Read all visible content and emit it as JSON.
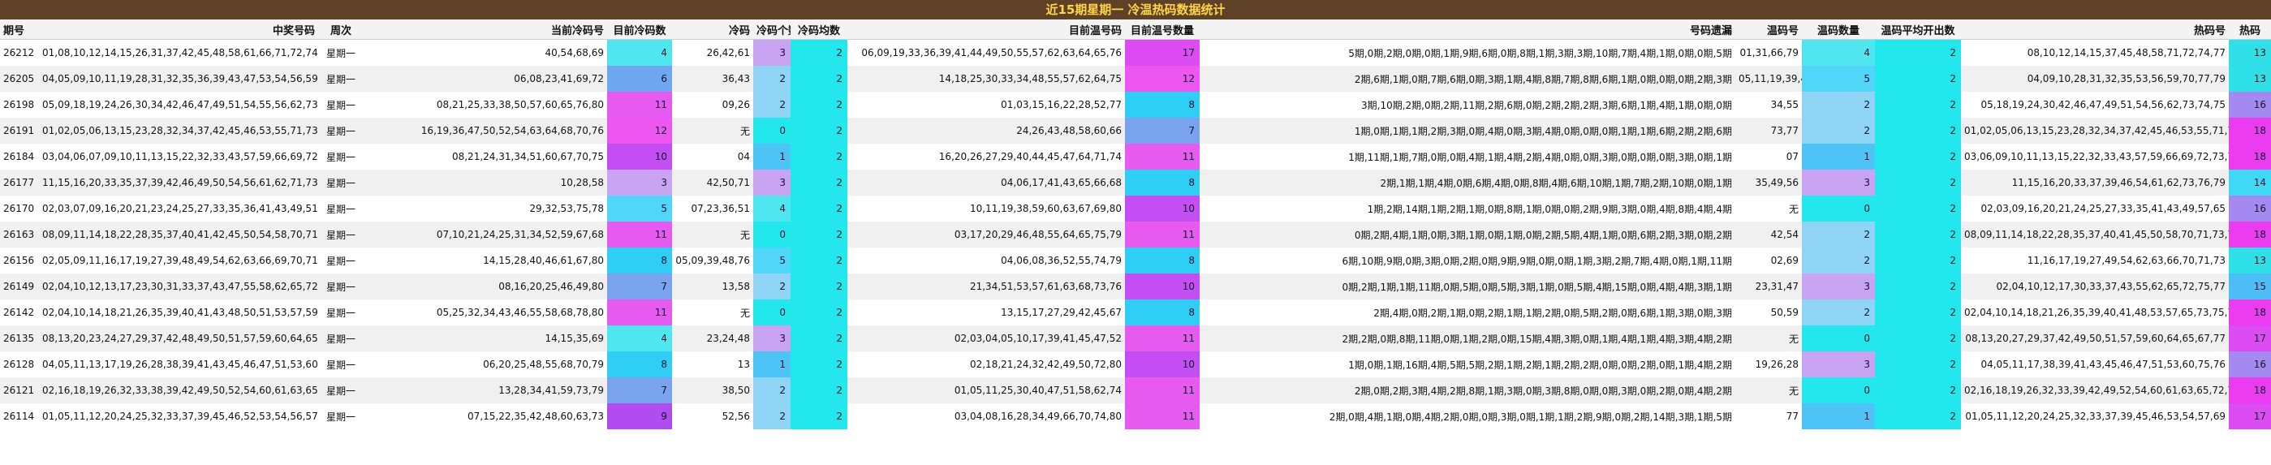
{
  "title": "近15期星期一 冷温热码数据统计",
  "headers": [
    "期号",
    "中奖号码",
    "周次",
    "当前冷码号",
    "目前冷码数",
    "冷码",
    "冷码个数",
    "冷码均数",
    "目前温号码",
    "目前温号数量",
    "号码遗漏",
    "温码号",
    "温码数量",
    "温码平均开出数",
    "热码号",
    "热码"
  ],
  "palette": {
    "2": "#8fd3f5",
    "3": "#c9a4f2",
    "4": "#4fe6f0",
    "5": "#4fd6f8",
    "6": "#6fa6f0",
    "7": "#7aa3ee",
    "8": "#2fcff5",
    "9": "#b04cf0",
    "10": "#c44ef4",
    "11": "#e65af0",
    "12": "#ee56f2",
    "13": "#2fe0e8",
    "14": "#3fd8f5",
    "15": "#4cbef5",
    "16": "#a489f0",
    "17": "#dd4cf2",
    "18": "#ec3cf0",
    "0": "#22e8ee",
    "1": "#4ec4f6"
  },
  "rows": [
    {
      "qihao": "26212",
      "win": "01,08,10,12,14,15,26,31,37,42,45,48,58,61,66,71,72,74,77,79",
      "week": "星期一",
      "cold_nums": "40,54,68,69",
      "cold_count": "4",
      "cold": "26,42,61",
      "cold_cnt": "3",
      "cold_avg": "2",
      "warm_nums": "06,09,19,33,36,39,41,44,49,50,55,57,62,63,64,65,76",
      "warm_count": "17",
      "miss": "5期,0期,2期,0期,0期,1期,9期,6期,0期,8期,1期,3期,3期,10期,7期,4期,1期,0期,0期,5期",
      "warm": "01,31,66,79",
      "warm_cnt": "4",
      "warm_avg": "2",
      "hot_nums": "08,10,12,14,15,37,45,48,58,71,72,74,77",
      "hot": "13"
    },
    {
      "qihao": "26205",
      "win": "04,05,09,10,11,19,28,31,32,35,36,39,43,47,53,54,56,59,70,77,79",
      "week": "星期一",
      "cold_nums": "06,08,23,41,69,72",
      "cold_count": "6",
      "cold": "36,43",
      "cold_cnt": "2",
      "cold_avg": "2",
      "warm_nums": "14,18,25,30,33,34,48,55,57,62,64,75",
      "warm_count": "12",
      "miss": "2期,6期,1期,0期,7期,6期,0期,3期,1期,4期,8期,7期,8期,6期,1期,0期,0期,0期,2期,3期",
      "warm": "05,11,19,39,47",
      "warm_cnt": "5",
      "warm_avg": "2",
      "hot_nums": "04,09,10,28,31,32,35,53,56,59,70,77,79",
      "hot": "13"
    },
    {
      "qihao": "26198",
      "win": "05,09,18,19,24,26,30,34,42,46,47,49,51,54,55,56,62,73,74,75",
      "week": "星期一",
      "cold_nums": "08,21,25,33,38,50,57,60,65,76,80",
      "cold_count": "11",
      "cold": "09,26",
      "cold_cnt": "2",
      "cold_avg": "2",
      "warm_nums": "01,03,15,16,22,28,52,77",
      "warm_count": "8",
      "miss": "3期,10期,2期,0期,2期,11期,2期,6期,0期,2期,2期,2期,3期,6期,1期,4期,1期,0期,0期",
      "warm": "34,55",
      "warm_cnt": "2",
      "warm_avg": "2",
      "hot_nums": "05,18,19,24,30,42,46,47,49,51,54,56,62,73,74,75",
      "hot": "16"
    },
    {
      "qihao": "26191",
      "win": "01,02,05,06,13,15,23,28,32,34,37,42,45,46,53,55,71,73,75,77",
      "week": "星期一",
      "cold_nums": "16,19,36,47,50,52,54,63,64,68,70,76",
      "cold_count": "12",
      "cold": "无",
      "cold_cnt": "0",
      "cold_avg": "2",
      "warm_nums": "24,26,43,48,58,60,66",
      "warm_count": "7",
      "miss": "1期,0期,1期,1期,2期,3期,0期,4期,0期,3期,4期,0期,0期,0期,1期,1期,6期,2期,2期,6期",
      "warm": "73,77",
      "warm_cnt": "2",
      "warm_avg": "2",
      "hot_nums": "01,02,05,06,13,15,23,28,32,34,37,42,45,46,53,55,71,75",
      "hot": "18"
    },
    {
      "qihao": "26184",
      "win": "03,04,06,07,09,10,11,13,15,22,32,33,43,57,59,66,69,72,73,77,78",
      "week": "星期一",
      "cold_nums": "08,21,24,31,34,51,60,67,70,75",
      "cold_count": "10",
      "cold": "04",
      "cold_cnt": "1",
      "cold_avg": "2",
      "warm_nums": "16,20,26,27,29,40,44,45,47,64,71,74",
      "warm_count": "11",
      "miss": "1期,11期,1期,7期,0期,0期,4期,1期,4期,2期,4期,0期,0期,3期,0期,0期,0期,3期,0期,1期",
      "warm": "07",
      "warm_cnt": "1",
      "warm_avg": "2",
      "hot_nums": "03,06,09,10,11,13,15,22,32,33,43,57,59,66,69,72,73,78",
      "hot": "18"
    },
    {
      "qihao": "26177",
      "win": "11,15,16,20,33,35,37,39,42,46,49,50,54,56,61,62,71,73,76,79",
      "week": "星期一",
      "cold_nums": "10,28,58",
      "cold_count": "3",
      "cold": "42,50,71",
      "cold_cnt": "3",
      "cold_avg": "2",
      "warm_nums": "04,06,17,41,43,65,66,68",
      "warm_count": "8",
      "miss": "2期,1期,1期,4期,0期,6期,4期,0期,8期,4期,6期,10期,1期,7期,2期,10期,0期,1期",
      "warm": "35,49,56",
      "warm_cnt": "3",
      "warm_avg": "2",
      "hot_nums": "11,15,16,20,33,37,39,46,54,61,62,73,76,79",
      "hot": "14"
    },
    {
      "qihao": "26170",
      "win": "02,03,07,09,16,20,21,23,24,25,27,33,35,36,41,43,49,51,57,65",
      "week": "星期一",
      "cold_nums": "29,32,53,75,78",
      "cold_count": "5",
      "cold": "07,23,36,51",
      "cold_cnt": "4",
      "cold_avg": "2",
      "warm_nums": "10,11,19,38,59,60,63,67,69,80",
      "warm_count": "10",
      "miss": "1期,2期,14期,1期,2期,1期,0期,8期,1期,0期,0期,2期,9期,3期,0期,4期,8期,4期,4期",
      "warm": "无",
      "warm_cnt": "0",
      "warm_avg": "2",
      "hot_nums": "02,03,09,16,20,21,24,25,27,33,35,41,43,49,57,65",
      "hot": "16"
    },
    {
      "qihao": "26163",
      "win": "08,09,11,14,18,22,28,35,37,40,41,42,45,50,54,58,70,71,73,74",
      "week": "星期一",
      "cold_nums": "07,10,21,24,25,31,34,52,59,67,68",
      "cold_count": "11",
      "cold": "无",
      "cold_cnt": "0",
      "cold_avg": "2",
      "warm_nums": "03,17,20,29,46,48,55,64,65,75,79",
      "warm_count": "11",
      "miss": "0期,2期,4期,1期,0期,3期,1期,0期,1期,0期,2期,5期,4期,1期,0期,6期,2期,3期,0期,2期",
      "warm": "42,54",
      "warm_cnt": "2",
      "warm_avg": "2",
      "hot_nums": "08,09,11,14,18,22,28,35,37,40,41,45,50,58,70,71,73,74",
      "hot": "18"
    },
    {
      "qihao": "26156",
      "win": "02,05,09,11,16,17,19,27,39,48,49,54,62,63,66,69,70,71,73,76",
      "week": "星期一",
      "cold_nums": "14,15,28,40,46,61,67,80",
      "cold_count": "8",
      "cold": "05,09,39,48,76",
      "cold_cnt": "5",
      "cold_avg": "2",
      "warm_nums": "04,06,08,36,52,55,74,79",
      "warm_count": "8",
      "miss": "6期,10期,9期,0期,3期,0期,2期,0期,9期,9期,0期,0期,1期,3期,2期,7期,4期,0期,1期,11期",
      "warm": "02,69",
      "warm_cnt": "2",
      "warm_avg": "2",
      "hot_nums": "11,16,17,19,27,49,54,62,63,66,70,71,73",
      "hot": "13"
    },
    {
      "qihao": "26149",
      "win": "02,04,10,12,13,17,23,30,31,33,37,43,47,55,58,62,65,72,75,77",
      "week": "星期一",
      "cold_nums": "08,16,20,25,46,49,80",
      "cold_count": "7",
      "cold": "13,58",
      "cold_cnt": "2",
      "cold_avg": "2",
      "warm_nums": "21,34,51,53,57,61,63,68,73,76",
      "warm_count": "10",
      "miss": "0期,2期,1期,1期,11期,0期,5期,0期,5期,3期,1期,0期,5期,4期,15期,0期,4期,4期,3期,1期",
      "warm": "23,31,47",
      "warm_cnt": "3",
      "warm_avg": "2",
      "hot_nums": "02,04,10,12,17,30,33,37,43,55,62,65,72,75,77",
      "hot": "15"
    },
    {
      "qihao": "26142",
      "win": "02,04,10,14,18,21,26,35,39,40,41,43,48,50,51,53,57,59,65,73,75,76",
      "week": "星期一",
      "cold_nums": "05,25,32,34,43,46,55,58,68,78,80",
      "cold_count": "11",
      "cold": "无",
      "cold_cnt": "0",
      "cold_avg": "2",
      "warm_nums": "13,15,17,27,29,42,45,67",
      "warm_count": "8",
      "miss": "2期,4期,0期,2期,1期,0期,2期,1期,1期,2期,0期,5期,2期,0期,6期,1期,3期,0期,3期",
      "warm": "50,59",
      "warm_cnt": "2",
      "warm_avg": "2",
      "hot_nums": "02,04,10,14,18,21,26,35,39,40,41,48,53,57,65,73,75,76",
      "hot": "18"
    },
    {
      "qihao": "26135",
      "win": "08,13,20,23,24,27,29,37,42,48,49,50,51,57,59,60,64,65,67,77",
      "week": "星期一",
      "cold_nums": "14,15,35,69",
      "cold_count": "4",
      "cold": "23,24,48",
      "cold_cnt": "3",
      "cold_avg": "2",
      "warm_nums": "02,03,04,05,10,17,39,41,45,47,52",
      "warm_count": "11",
      "miss": "2期,2期,0期,8期,11期,0期,1期,2期,0期,15期,4期,3期,0期,1期,4期,1期,4期,3期,4期,2期",
      "warm": "无",
      "warm_cnt": "0",
      "warm_avg": "2",
      "hot_nums": "08,13,20,27,29,37,42,49,50,51,57,59,60,64,65,67,77",
      "hot": "17"
    },
    {
      "qihao": "26128",
      "win": "04,05,11,13,17,19,26,28,38,39,41,43,45,46,47,51,53,60,75,76",
      "week": "星期一",
      "cold_nums": "06,20,25,48,55,68,70,79",
      "cold_count": "8",
      "cold": "13",
      "cold_cnt": "1",
      "cold_avg": "2",
      "warm_nums": "02,18,21,24,32,42,49,50,72,80",
      "warm_count": "10",
      "miss": "1期,0期,1期,16期,4期,5期,5期,2期,1期,2期,1期,2期,2期,0期,0期,2期,0期,1期,4期,2期",
      "warm": "19,26,28",
      "warm_cnt": "3",
      "warm_avg": "2",
      "hot_nums": "04,05,11,17,38,39,41,43,45,46,47,51,53,60,75,76",
      "hot": "16"
    },
    {
      "qihao": "26121",
      "win": "02,16,18,19,26,32,33,38,39,42,49,50,52,54,60,61,63,65,72,78",
      "week": "星期一",
      "cold_nums": "13,28,34,41,59,73,79",
      "cold_count": "7",
      "cold": "38,50",
      "cold_cnt": "2",
      "cold_avg": "2",
      "warm_nums": "01,05,11,25,30,40,47,51,58,62,74",
      "warm_count": "11",
      "miss": "2期,0期,2期,3期,4期,2期,8期,1期,3期,0期,3期,8期,0期,0期,3期,0期,2期,0期,4期,2期",
      "warm": "无",
      "warm_cnt": "0",
      "warm_avg": "2",
      "hot_nums": "02,16,18,19,26,32,33,39,42,49,52,54,60,61,63,65,72,78",
      "hot": "18"
    },
    {
      "qihao": "26114",
      "win": "01,05,11,12,20,24,25,32,33,37,39,45,46,52,53,54,56,57,69,77",
      "week": "星期一",
      "cold_nums": "07,15,22,35,42,48,60,63,73",
      "cold_count": "9",
      "cold": "52,56",
      "cold_cnt": "2",
      "cold_avg": "2",
      "warm_nums": "03,04,08,16,28,34,49,66,70,74,80",
      "warm_count": "11",
      "miss": "2期,0期,4期,1期,0期,4期,2期,0期,0期,3期,0期,1期,1期,2期,9期,0期,2期,14期,3期,1期,5期",
      "warm": "77",
      "warm_cnt": "1",
      "warm_avg": "2",
      "hot_nums": "01,05,11,12,20,24,25,32,33,37,39,45,46,53,54,57,69",
      "hot": "17"
    }
  ]
}
